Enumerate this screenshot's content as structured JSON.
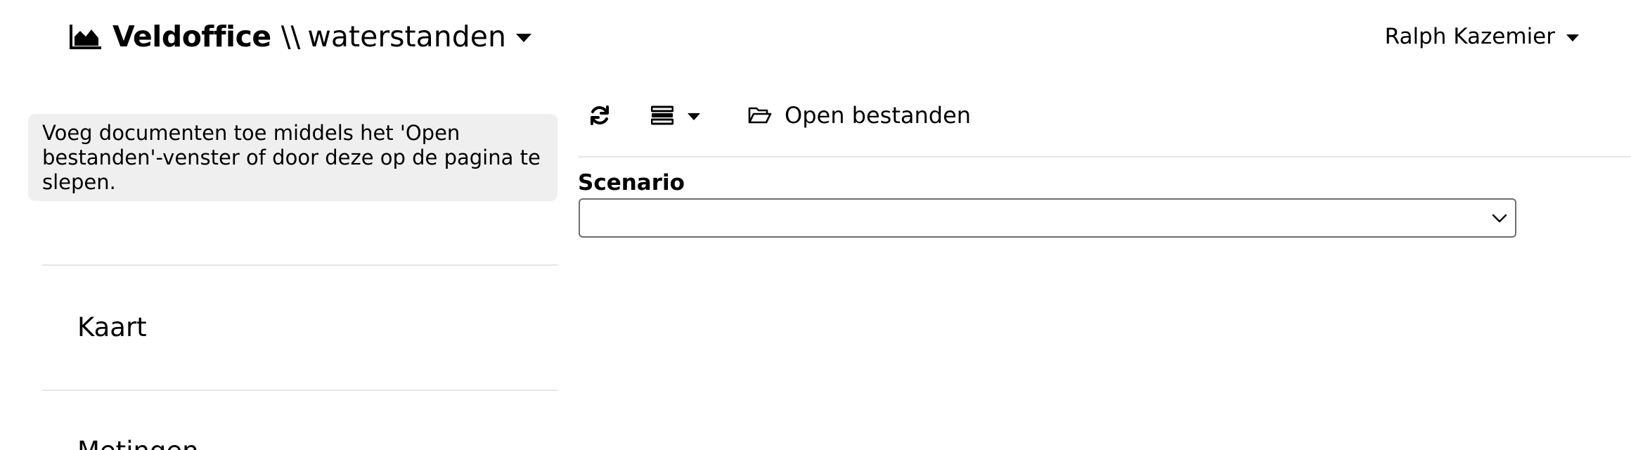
{
  "header": {
    "brand_name": "Veldoffice",
    "separator": "\\\\",
    "module": "waterstanden",
    "user_name": "Ralph Kazemier"
  },
  "sidebar": {
    "hint": "Voeg documenten toe middels het 'Open bestanden'-venster of door deze op de pagina te slepen.",
    "items": [
      {
        "label": "Kaart"
      },
      {
        "label": "Metingen"
      }
    ]
  },
  "toolbar": {
    "icons": [
      "refresh-icon",
      "list-view-icon",
      "folder-open-icon"
    ],
    "open_files_label": "Open bestanden"
  },
  "form": {
    "scenario_label": "Scenario",
    "scenario_value": ""
  }
}
